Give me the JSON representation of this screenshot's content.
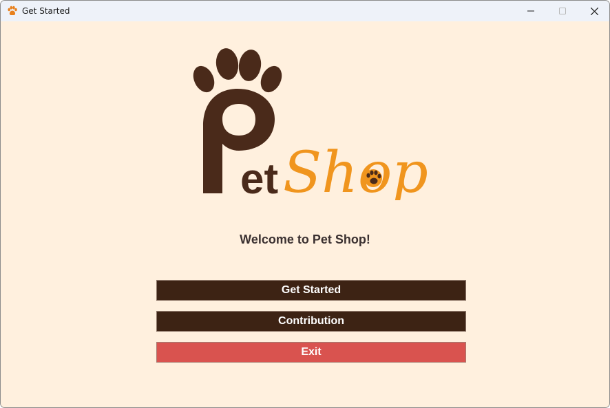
{
  "window": {
    "title": "Get Started",
    "app_icon": "paw-icon",
    "controls": {
      "minimize_icon": "minimize-icon",
      "maximize_icon": "maximize-icon",
      "close_icon": "close-icon"
    }
  },
  "logo": {
    "word_pet": "Pet",
    "word_shop": "Shop",
    "colors": {
      "brown": "#4a2a1a",
      "orange": "#f0951e"
    }
  },
  "welcome_text": "Welcome to Pet Shop!",
  "buttons": {
    "get_started": "Get Started",
    "contribution": "Contribution",
    "exit": "Exit"
  },
  "colors": {
    "background": "#fff0de",
    "primary_button": "#3d2314",
    "exit_button": "#d9534f",
    "button_text": "#ffffff"
  }
}
